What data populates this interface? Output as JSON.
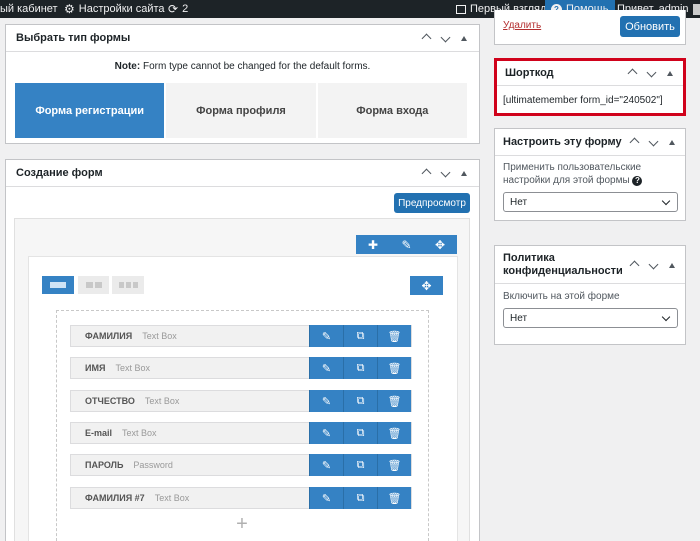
{
  "adminbar": {
    "cabinet": "ый кабинет",
    "site_settings": "Настройки сайта",
    "updates_count": "2",
    "first_look": "Первый взгляд",
    "help": "Помощь",
    "greeting": "Привет, admin"
  },
  "form_type_box": {
    "title": "Выбрать тип формы",
    "note_bold": "Note:",
    "note_text": "Form type cannot be changed for the default forms.",
    "tabs": [
      "Форма регистрации",
      "Форма профиля",
      "Форма входа"
    ]
  },
  "builder_box": {
    "title": "Создание форм",
    "preview_button": "Предпросмотр",
    "fields": [
      {
        "label": "ФАМИЛИЯ",
        "type": "Text Box"
      },
      {
        "label": "ИМЯ",
        "type": "Text Box"
      },
      {
        "label": "ОТЧЕСТВО",
        "type": "Text Box"
      },
      {
        "label": "E-mail",
        "type": "Text Box"
      },
      {
        "label": "ПАРОЛЬ",
        "type": "Password"
      },
      {
        "label": "ФАМИЛИЯ #7",
        "type": "Text Box"
      }
    ],
    "add_symbol": "+"
  },
  "publish": {
    "delete_link": "Удалить",
    "update_button": "Обновить"
  },
  "shortcode_box": {
    "title": "Шорткод",
    "value": "[ultimatemember form_id=\"240502\"]",
    "highlight_color": "#d0021b"
  },
  "customize_box": {
    "title": "Настроить эту форму",
    "label": "Применить пользовательские настройки для этой формы",
    "help_symbol": "?",
    "selected": "Нет"
  },
  "privacy_box": {
    "title": "Политика конфиденциальности",
    "label": "Включить на этой форме",
    "selected": "Нет"
  },
  "colors": {
    "accent": "#3582c4",
    "wp_blue": "#2271b1",
    "adminbar_bg": "#1d2327"
  }
}
